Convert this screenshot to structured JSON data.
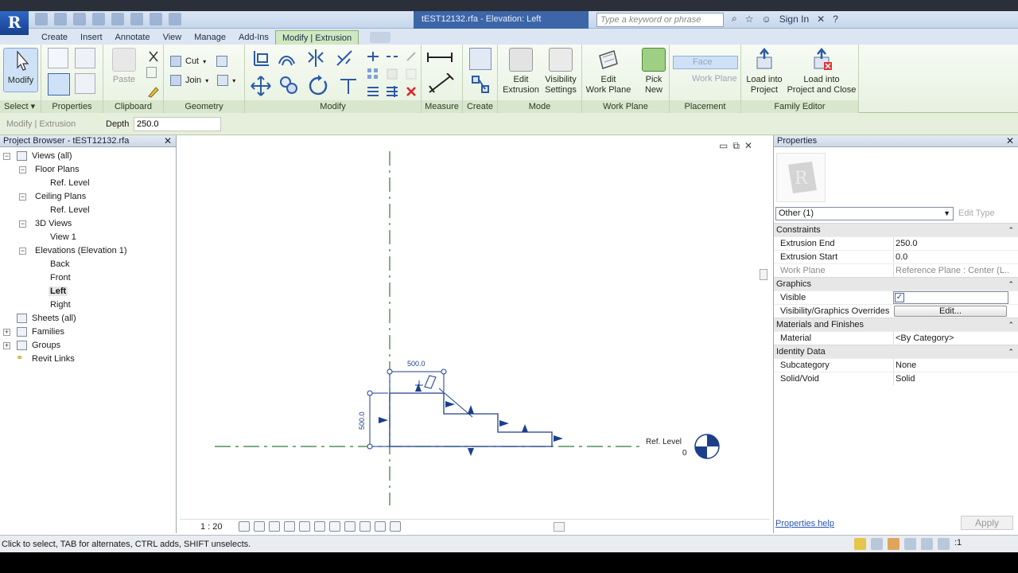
{
  "app": {
    "logo_letter": "R",
    "title": "tEST12132.rfa - Elevation: Left",
    "search_placeholder": "Type a keyword or phrase",
    "sign_in": "Sign In"
  },
  "tabs": [
    {
      "label": "Create"
    },
    {
      "label": "Insert"
    },
    {
      "label": "Annotate"
    },
    {
      "label": "View"
    },
    {
      "label": "Manage"
    },
    {
      "label": "Add-Ins"
    },
    {
      "label": "Modify | Extrusion"
    }
  ],
  "ribbon": {
    "select_panel": {
      "label": "Select",
      "modify_label": "Modify"
    },
    "properties_panel": {
      "label": "Properties"
    },
    "clipboard_panel": {
      "label": "Clipboard",
      "paste_label": "Paste"
    },
    "geometry_panel": {
      "label": "Geometry",
      "cut_label": "Cut",
      "join_label": "Join"
    },
    "modify_panel": {
      "label": "Modify"
    },
    "measure_panel": {
      "label": "Measure"
    },
    "create_panel": {
      "label": "Create"
    },
    "mode_panel": {
      "label": "Mode",
      "edit_extrusion_1": "Edit",
      "edit_extrusion_2": "Extrusion",
      "visibility_1": "Visibility",
      "visibility_2": "Settings"
    },
    "work_plane_panel": {
      "label": "Work Plane",
      "edit_wp_1": "Edit",
      "edit_wp_2": "Work Plane",
      "pick_new_1": "Pick",
      "pick_new_2": "New"
    },
    "placement_panel": {
      "label": "Placement",
      "face_label": "Face",
      "work_plane_label": "Work Plane"
    },
    "family_editor_panel": {
      "label": "Family Editor",
      "load_1": "Load into",
      "load_2": "Project",
      "load_close_1": "Load into",
      "load_close_2": "Project and Close"
    }
  },
  "options_bar": {
    "context": "Modify | Extrusion",
    "depth_label": "Depth",
    "depth_value": "250.0"
  },
  "project_browser": {
    "title": "Project Browser - tEST12132.rfa",
    "tree": {
      "views_all": "Views (all)",
      "floor_plans": "Floor Plans",
      "floor_ref_level": "Ref. Level",
      "ceiling_plans": "Ceiling Plans",
      "ceiling_ref_level": "Ref. Level",
      "views_3d": "3D Views",
      "view_1": "View 1",
      "elevations": "Elevations (Elevation 1)",
      "back": "Back",
      "front": "Front",
      "left": "Left",
      "right": "Right",
      "sheets": "Sheets (all)",
      "families": "Families",
      "groups": "Groups",
      "revit_links": "Revit Links"
    }
  },
  "canvas": {
    "dim_width": "500.0",
    "dim_height": "500.0",
    "level_name": "Ref. Level",
    "level_elev": "0",
    "scale": "1 : 20"
  },
  "properties": {
    "title": "Properties",
    "type_selector": "Other (1)",
    "edit_type": "Edit Type",
    "constraints": "Constraints",
    "extrusion_end_label": "Extrusion End",
    "extrusion_end_value": "250.0",
    "extrusion_start_label": "Extrusion Start",
    "extrusion_start_value": "0.0",
    "work_plane_label": "Work Plane",
    "work_plane_value": "Reference Plane : Center (L...",
    "graphics": "Graphics",
    "visible_label": "Visible",
    "vg_overrides_label": "Visibility/Graphics Overrides",
    "vg_overrides_btn": "Edit...",
    "materials": "Materials and Finishes",
    "material_label": "Material",
    "material_value": "<By Category>",
    "identity": "Identity Data",
    "subcategory_label": "Subcategory",
    "subcategory_value": "None",
    "solid_void_label": "Solid/Void",
    "solid_void_value": "Solid",
    "help_link": "Properties help",
    "apply": "Apply"
  },
  "status": {
    "text": "Click to select, TAB for alternates, CTRL adds, SHIFT unselects.",
    "filter_count": ":1"
  },
  "colors": {
    "accent": "#3c66a8",
    "context_tab": "#cfe8c2",
    "ref_plane": "#2f7a3a",
    "sketch": "#1c3f8c"
  }
}
